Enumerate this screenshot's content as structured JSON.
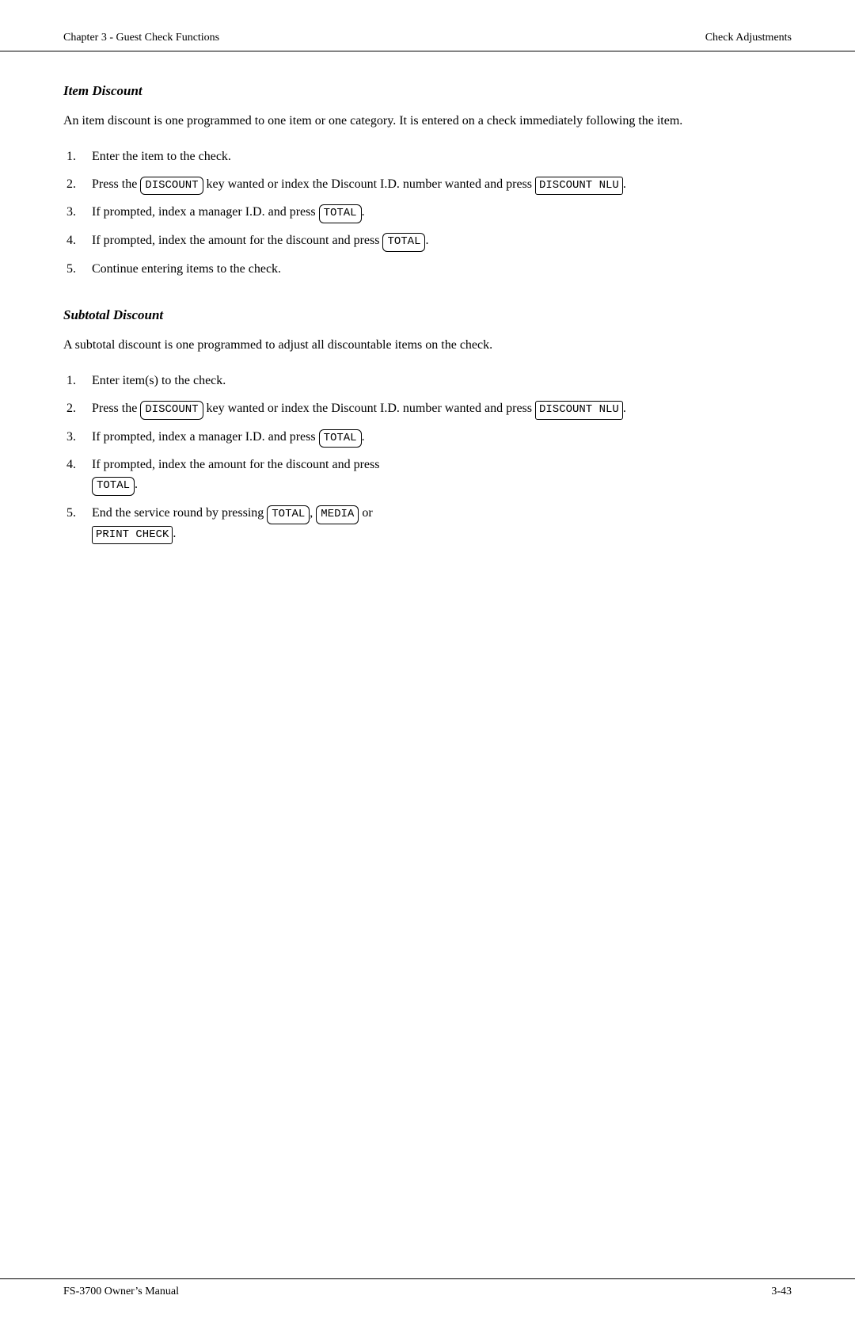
{
  "header": {
    "left": "Chapter 3 - Guest Check Functions",
    "right": "Check Adjustments"
  },
  "footer": {
    "left": "FS-3700 Owner’s Manual",
    "right": "3-43"
  },
  "sections": [
    {
      "id": "item-discount",
      "heading": "Item Discount",
      "intro": "An item discount is one programmed to one item or one category.  It is entered on a check immediately following the item.",
      "steps": [
        {
          "num": "1.",
          "text_plain": "Enter the item to the check."
        },
        {
          "num": "2.",
          "text_plain": "Press the [DISCOUNT] key wanted or index the Discount I.D. number wanted and press [DISCOUNT NLU]."
        },
        {
          "num": "3.",
          "text_plain": "If prompted, index a manager I.D. and press [TOTAL]."
        },
        {
          "num": "4.",
          "text_plain": "If prompted, index the amount for the discount and press [TOTAL]."
        },
        {
          "num": "5.",
          "text_plain": "Continue entering items to the check."
        }
      ]
    },
    {
      "id": "subtotal-discount",
      "heading": "Subtotal Discount",
      "intro": "A subtotal discount is one programmed to adjust all discountable items on the check.",
      "steps": [
        {
          "num": "1.",
          "text_plain": "Enter item(s) to the check."
        },
        {
          "num": "2.",
          "text_plain": "Press the [DISCOUNT] key wanted or index the Discount I.D. number wanted and press [DISCOUNT NLU]."
        },
        {
          "num": "3.",
          "text_plain": "If prompted, index a manager I.D. and press [TOTAL]."
        },
        {
          "num": "4.",
          "text_plain": "If prompted, index the amount for the discount and press [TOTAL]."
        },
        {
          "num": "5.",
          "text_plain": "End the service round by pressing [TOTAL], [MEDIA] or [PRINT CHECK]."
        }
      ]
    }
  ]
}
